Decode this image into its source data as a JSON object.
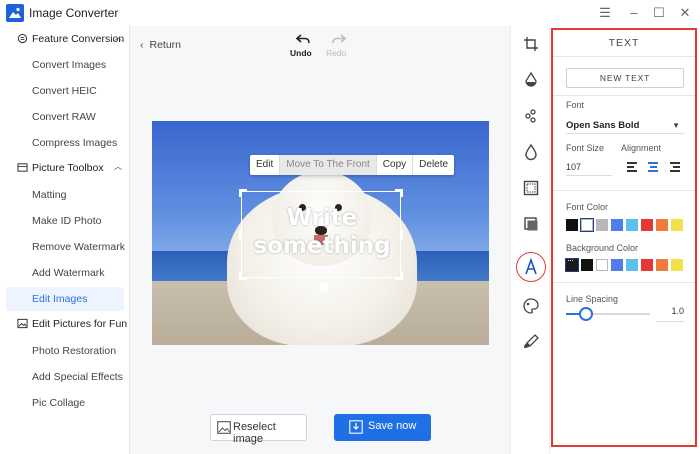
{
  "app": {
    "title": "Image Converter"
  },
  "window_controls": {
    "menu": "☰",
    "minimize": "–",
    "maximize": "☐",
    "close": "✕"
  },
  "sidebar": {
    "groups": [
      {
        "label": "Feature Conversion",
        "items": [
          "Convert Images",
          "Convert HEIC",
          "Convert RAW",
          "Compress Images"
        ]
      },
      {
        "label": "Picture Toolbox",
        "items": [
          "Matting",
          "Make ID Photo",
          "Remove Watermark",
          "Add Watermark",
          "Edit Images"
        ]
      },
      {
        "label": "Edit Pictures for Fun",
        "items": [
          "Photo Restoration",
          "Add Special Effects",
          "Pic Collage"
        ]
      }
    ],
    "active_item": "Edit Images"
  },
  "toolbar": {
    "return_label": "Return",
    "undo_label": "Undo",
    "redo_label": "Redo"
  },
  "context_menu": {
    "edit": "Edit",
    "move_front": "Move To The Front",
    "copy": "Copy",
    "delete": "Delete"
  },
  "canvas": {
    "text_line1": "Write",
    "text_line2": "something"
  },
  "actions": {
    "reselect_label": "Reselect image",
    "save_label": "Save now"
  },
  "tools": [
    "crop-icon",
    "color-drop-icon",
    "nodes-icon",
    "droplet-icon",
    "frame-icon",
    "layers-icon",
    "text-icon",
    "palette-icon",
    "brush-icon"
  ],
  "panel": {
    "title": "TEXT",
    "new_text_label": "NEW TEXT",
    "font_label": "Font",
    "font_value": "Open Sans Bold",
    "font_size_label": "Font Size",
    "font_size_value": "107",
    "alignment_label": "Alignment",
    "alignment_selected": "center",
    "font_color_label": "Font Color",
    "font_colors": [
      "#111111",
      "#ffffff",
      "#b8b8b8",
      "#4f7df0",
      "#5bc0eb",
      "#e53935",
      "#f07b3f",
      "#f4e04d"
    ],
    "font_color_selected": "#ffffff",
    "bg_color_label": "Background Color",
    "bg_colors": [
      "#1a1a1a",
      "#111111",
      "#ffffff",
      "#4f7df0",
      "#5bc0eb",
      "#e53935",
      "#f07b3f",
      "#f4e04d"
    ],
    "line_spacing_label": "Line Spacing",
    "line_spacing_value": "1.0",
    "line_spacing_level": 0.15
  },
  "colors": {
    "accent": "#1f6fe5",
    "highlight": "#e53935"
  }
}
